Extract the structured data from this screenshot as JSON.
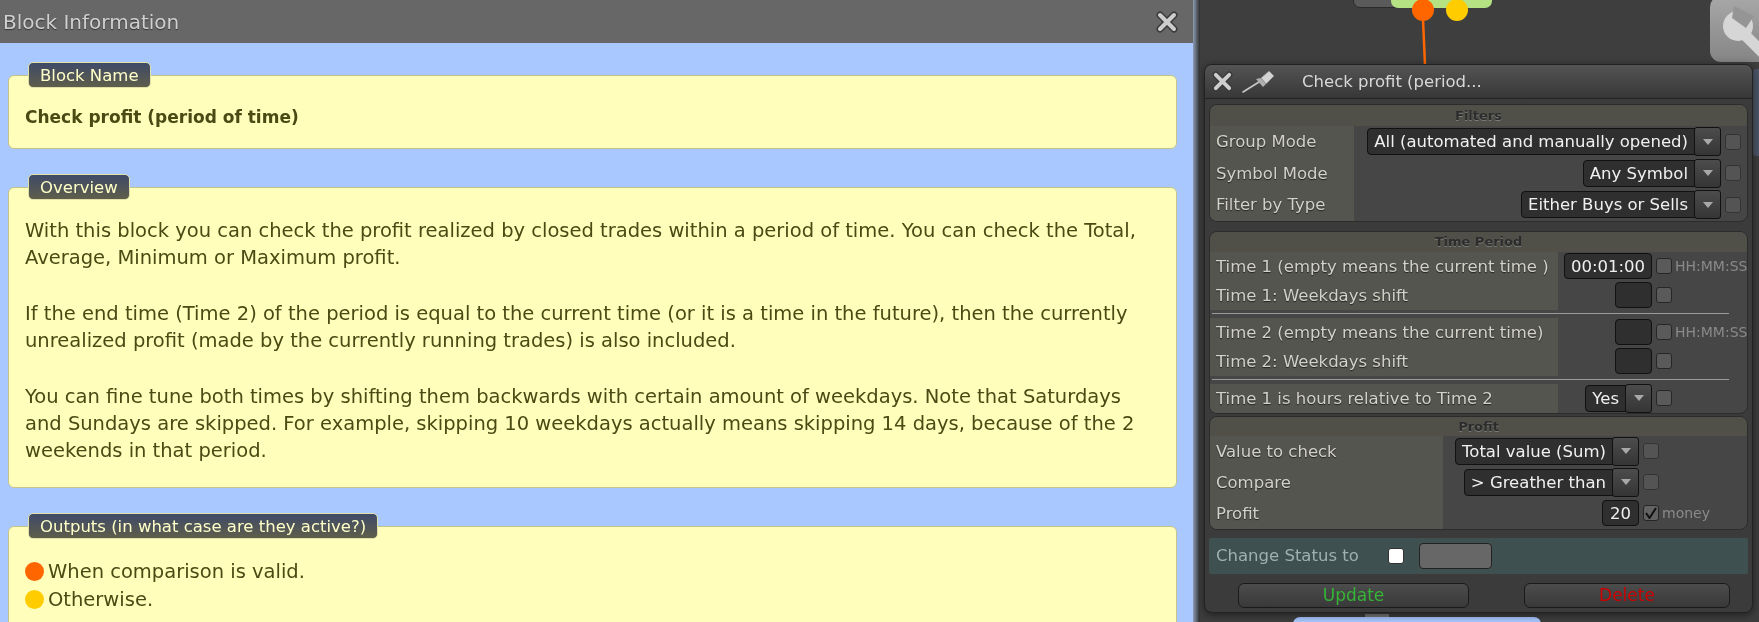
{
  "info_panel": {
    "title": "Block Information",
    "sections": [
      {
        "kind": "name",
        "legend": "Block Name",
        "text": "Check profit (period of time)"
      },
      {
        "kind": "text",
        "legend": "Overview",
        "paragraphs": [
          [
            "With this block you can check the profit realized by closed trades within a period of time. You can check the Total,",
            "Average, Minimum or Maximum profit."
          ],
          [
            "If the end time (Time 2) of the period is equal to the current time (or it is a time in the future), then the currently",
            "unrealized profit (made by the currently running trades) is also included."
          ],
          [
            "You can fine tune both times by shifting them backwards with certain amount of weekdays. Note that Saturdays",
            "and Sundays are skipped. For example, skipping 10 weekdays actually means skipping 14 days, because of the 2",
            "weekends in that period."
          ]
        ]
      },
      {
        "kind": "outputs",
        "legend": "Outputs (in what case are they active?)",
        "items": [
          {
            "color": "#ff6600",
            "text": "When comparison is valid."
          },
          {
            "color": "#ffcc00",
            "text": "Otherwise."
          }
        ]
      }
    ]
  },
  "canvas": {
    "node": {
      "outputs": [
        {
          "color": "#ff6600"
        },
        {
          "color": "#ffcc00"
        }
      ]
    }
  },
  "dialog": {
    "title": "Check profit (period...",
    "sections": [
      {
        "title": "Filters",
        "groups": [
          [
            {
              "label": "Group Mode",
              "kind": "select",
              "value": "All (automated and manually opened)",
              "checked": false,
              "disabled": true
            },
            {
              "label": "Symbol Mode",
              "kind": "select",
              "value": "Any Symbol",
              "checked": false,
              "disabled": true
            },
            {
              "label": "Filter by Type",
              "kind": "select",
              "value": "Either Buys or Sells",
              "checked": false,
              "disabled": true
            }
          ]
        ]
      },
      {
        "title": "Time Period",
        "groups": [
          [
            {
              "label": "Time 1 (empty means the current time )",
              "kind": "input",
              "value": "00:01:00",
              "checked": false,
              "disabled": false,
              "unit": "HH:MM:SS"
            },
            {
              "label": "Time 1: Weekdays shift",
              "kind": "input",
              "checked": false,
              "disabled": false
            }
          ],
          [
            {
              "label": "Time 2 (empty means the current time)",
              "kind": "input",
              "checked": false,
              "disabled": false,
              "unit": "HH:MM:SS"
            },
            {
              "label": "Time 2: Weekdays shift",
              "kind": "input",
              "checked": false,
              "disabled": false
            }
          ],
          [
            {
              "label": "Time 1 is hours relative to Time 2",
              "kind": "select",
              "value": "Yes",
              "checked": false,
              "disabled": false
            }
          ]
        ]
      },
      {
        "title": "Profit",
        "groups": [
          [
            {
              "label": "Value to check",
              "kind": "select",
              "value": "Total value (Sum)",
              "checked": false,
              "disabled": true
            },
            {
              "label": "Compare",
              "kind": "select",
              "value": "> Greather than",
              "checked": false,
              "disabled": true
            },
            {
              "label": "Profit",
              "kind": "input",
              "value": "20",
              "checked": true,
              "disabled": false,
              "unit": "money"
            }
          ]
        ]
      }
    ],
    "status": {
      "label": "Change Status to",
      "checked": false
    },
    "buttons": [
      {
        "label": "Update",
        "kind": "update"
      },
      {
        "label": "Delete",
        "kind": "delete"
      }
    ]
  }
}
